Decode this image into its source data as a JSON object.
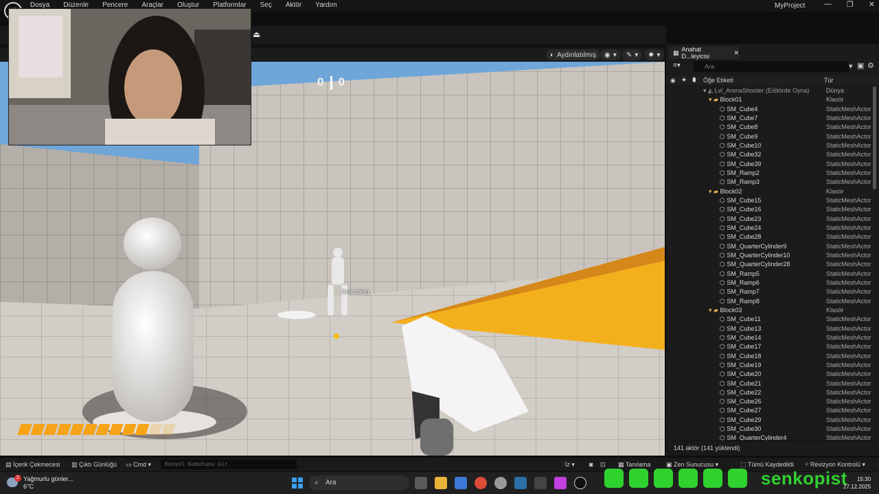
{
  "menu": {
    "logo": "U",
    "items": [
      "Dosya",
      "Düzenle",
      "Pencere",
      "Araçlar",
      "Oluştur",
      "Platformlar",
      "Seç",
      "Aktör",
      "Yardım"
    ],
    "project": "MyProject",
    "window_controls": [
      "—",
      "❐",
      "✕"
    ]
  },
  "viewport": {
    "lit_mode": "Aydınlatılmış",
    "score_left": "0",
    "score_right": "0",
    "enemy_status": "Searching",
    "ammo_total": 12,
    "ammo_filled": 10,
    "accent": "#f5a317"
  },
  "outliner": {
    "tab_title": "Anahat D...leyicisi",
    "search_placeholder": "Ara",
    "col_label": "Öğe Etiketi",
    "col_type": "Tür",
    "rows": [
      {
        "indent": 0,
        "kind": "root",
        "name": "Lvl_ArenaShooter (Editörde Oyna)",
        "type": "Dünya"
      },
      {
        "indent": 1,
        "kind": "folder",
        "name": "Block01",
        "type": "Klasör"
      },
      {
        "indent": 2,
        "kind": "mesh",
        "name": "SM_Cube4",
        "type": "StaticMeshActor"
      },
      {
        "indent": 2,
        "kind": "mesh",
        "name": "SM_Cube7",
        "type": "StaticMeshActor"
      },
      {
        "indent": 2,
        "kind": "mesh",
        "name": "SM_Cube8",
        "type": "StaticMeshActor"
      },
      {
        "indent": 2,
        "kind": "mesh",
        "name": "SM_Cube9",
        "type": "StaticMeshActor"
      },
      {
        "indent": 2,
        "kind": "mesh",
        "name": "SM_Cube10",
        "type": "StaticMeshActor"
      },
      {
        "indent": 2,
        "kind": "mesh",
        "name": "SM_Cube32",
        "type": "StaticMeshActor"
      },
      {
        "indent": 2,
        "kind": "mesh",
        "name": "SM_Cube39",
        "type": "StaticMeshActor"
      },
      {
        "indent": 2,
        "kind": "mesh",
        "name": "SM_Ramp2",
        "type": "StaticMeshActor"
      },
      {
        "indent": 2,
        "kind": "mesh",
        "name": "SM_Ramp3",
        "type": "StaticMeshActor"
      },
      {
        "indent": 1,
        "kind": "folder",
        "name": "Block02",
        "type": "Klasör"
      },
      {
        "indent": 2,
        "kind": "mesh",
        "name": "SM_Cube15",
        "type": "StaticMeshActor"
      },
      {
        "indent": 2,
        "kind": "mesh",
        "name": "SM_Cube16",
        "type": "StaticMeshActor"
      },
      {
        "indent": 2,
        "kind": "mesh",
        "name": "SM_Cube23",
        "type": "StaticMeshActor"
      },
      {
        "indent": 2,
        "kind": "mesh",
        "name": "SM_Cube24",
        "type": "StaticMeshActor"
      },
      {
        "indent": 2,
        "kind": "mesh",
        "name": "SM_Cube28",
        "type": "StaticMeshActor"
      },
      {
        "indent": 2,
        "kind": "mesh",
        "name": "SM_QuarterCylinder9",
        "type": "StaticMeshActor"
      },
      {
        "indent": 2,
        "kind": "mesh",
        "name": "SM_QuarterCylinder10",
        "type": "StaticMeshActor"
      },
      {
        "indent": 2,
        "kind": "mesh",
        "name": "SM_QuarterCylinder28",
        "type": "StaticMeshActor"
      },
      {
        "indent": 2,
        "kind": "mesh",
        "name": "SM_Ramp5",
        "type": "StaticMeshActor"
      },
      {
        "indent": 2,
        "kind": "mesh",
        "name": "SM_Ramp6",
        "type": "StaticMeshActor"
      },
      {
        "indent": 2,
        "kind": "mesh",
        "name": "SM_Ramp7",
        "type": "StaticMeshActor"
      },
      {
        "indent": 2,
        "kind": "mesh",
        "name": "SM_Ramp8",
        "type": "StaticMeshActor"
      },
      {
        "indent": 1,
        "kind": "folder",
        "name": "Block03",
        "type": "Klasör"
      },
      {
        "indent": 2,
        "kind": "mesh",
        "name": "SM_Cube11",
        "type": "StaticMeshActor"
      },
      {
        "indent": 2,
        "kind": "mesh",
        "name": "SM_Cube13",
        "type": "StaticMeshActor"
      },
      {
        "indent": 2,
        "kind": "mesh",
        "name": "SM_Cube14",
        "type": "StaticMeshActor"
      },
      {
        "indent": 2,
        "kind": "mesh",
        "name": "SM_Cube17",
        "type": "StaticMeshActor"
      },
      {
        "indent": 2,
        "kind": "mesh",
        "name": "SM_Cube18",
        "type": "StaticMeshActor"
      },
      {
        "indent": 2,
        "kind": "mesh",
        "name": "SM_Cube19",
        "type": "StaticMeshActor"
      },
      {
        "indent": 2,
        "kind": "mesh",
        "name": "SM_Cube20",
        "type": "StaticMeshActor"
      },
      {
        "indent": 2,
        "kind": "mesh",
        "name": "SM_Cube21",
        "type": "StaticMeshActor"
      },
      {
        "indent": 2,
        "kind": "mesh",
        "name": "SM_Cube22",
        "type": "StaticMeshActor"
      },
      {
        "indent": 2,
        "kind": "mesh",
        "name": "SM_Cube26",
        "type": "StaticMeshActor"
      },
      {
        "indent": 2,
        "kind": "mesh",
        "name": "SM_Cube27",
        "type": "StaticMeshActor"
      },
      {
        "indent": 2,
        "kind": "mesh",
        "name": "SM_Cube29",
        "type": "StaticMeshActor"
      },
      {
        "indent": 2,
        "kind": "mesh",
        "name": "SM_Cube30",
        "type": "StaticMeshActor"
      },
      {
        "indent": 2,
        "kind": "mesh",
        "name": "SM_QuarterCylinder4",
        "type": "StaticMeshActor"
      }
    ],
    "footer": "141 aktör (141 yüklendi)"
  },
  "statusbar": {
    "content_drawer": "İçerik Çekmecesi",
    "output_log": "Çıktı Günlüğü",
    "cmd": "Cmd",
    "cmd_placeholder": "Konsol Komutunu Gir",
    "trace": "İz",
    "diagnostics": "Tanılama",
    "zen": "Zen Sunucusu",
    "save_all": "Tümü Kaydedildi",
    "revision": "Revizyon Kontrolü"
  },
  "taskbar": {
    "weather_badge": "2",
    "weather_line1": "Yağmurlu günler...",
    "weather_line2": "6°C",
    "search_label": "Ara",
    "brand": "senkopist",
    "time": "15:30",
    "date": "27.12.2025"
  },
  "colors": {
    "brand_green": "#2fd12e",
    "folder": "#e0b354",
    "win_blue": "#3ba0f5"
  }
}
